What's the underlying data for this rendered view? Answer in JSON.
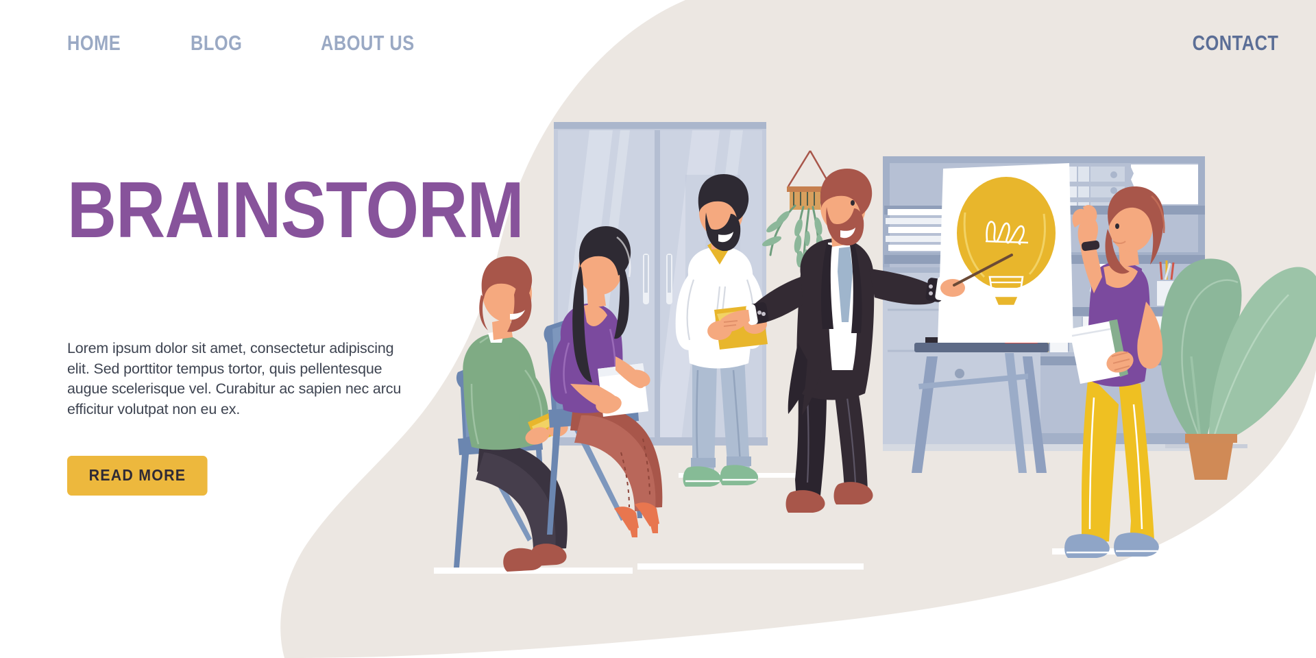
{
  "nav": {
    "items": [
      {
        "id": "home",
        "label": "HOME"
      },
      {
        "id": "blog",
        "label": "BLOG"
      },
      {
        "id": "about",
        "label": "ABOUT US"
      }
    ],
    "contact": {
      "label": "CONTACT"
    }
  },
  "hero": {
    "title": "BRAINSTORM",
    "paragraph": "Lorem ipsum dolor sit amet, consectetur adipiscing elit. Sed porttitor tempus tortor, quis pellentesque augue scelerisque vel. Curabitur ac sapien nec arcu efficitur volutpat non eu ex.",
    "cta_label": "READ MORE"
  },
  "colors": {
    "background": "#ffffff",
    "blob_beige": "#ece7e2",
    "nav_link": "#9aa9c4",
    "nav_contact": "#5b6e96",
    "heading_purple": "#87539b",
    "body_text": "#3e4451",
    "cta_yellow": "#edb83d",
    "cta_text": "#2f2a35",
    "wall": "#ece7e2",
    "cabinet_glass": "#c8cfdf",
    "cabinet_frame": "#aeb9d0",
    "shelf_unit": "#9fadc6",
    "bulb_yellow": "#e8b62c",
    "plant_green": "#8cb79a",
    "pot_terracotta": "#d08a56",
    "suit_dark": "#332a33",
    "sweater_green": "#7fab84",
    "blouse_purple": "#7b4a9e",
    "pants_red": "#a8564a",
    "pants_yellow": "#efc022",
    "shirt_white": "#ffffff",
    "skin": "#f5a97f",
    "hair_brown": "#9e4a3a",
    "hair_dark": "#2e2a33",
    "floor_line": "#ffffff"
  },
  "illustration": {
    "scene_name": "brainstorm-meeting-scene",
    "elements": [
      {
        "name": "glass-cabinet",
        "description": "tall two-door glass office cabinet"
      },
      {
        "name": "hanging-planter",
        "description": "macrame hanging planter with trailing fern"
      },
      {
        "name": "shelving-unit",
        "description": "office shelves with binders, papers and pencil cup"
      },
      {
        "name": "flipchart-easel",
        "description": "whiteboard easel with yellow lightbulb drawing"
      },
      {
        "name": "lightbulb-drawing",
        "description": "large yellow lightbulb idea sketch"
      },
      {
        "name": "potted-plant",
        "description": "large leafy plant in terracotta pot"
      },
      {
        "name": "seated-man-green-sweater",
        "description": "bearded man seated holding a yellow book"
      },
      {
        "name": "seated-woman-purple-top",
        "description": "woman seated with notebook, red trousers, heels"
      },
      {
        "name": "standing-man-white-shirt",
        "description": "man standing holding a yellow folder"
      },
      {
        "name": "presenter-man-suit",
        "description": "bearded presenter in dark suit with pointer stick"
      },
      {
        "name": "standing-woman-yellow-pants",
        "description": "woman with raised hand holding notebook"
      }
    ]
  }
}
